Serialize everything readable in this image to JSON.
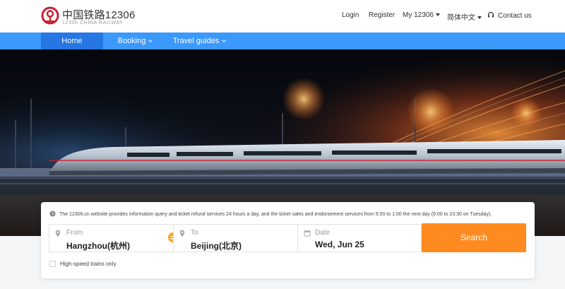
{
  "brand": {
    "title": "中国铁路12306",
    "subtitle": "12306 CHINA RAILWAY"
  },
  "topnav": {
    "login": "Login",
    "register": "Register",
    "my12306": "My 12306",
    "language": "简体中文",
    "contact": "Contact us"
  },
  "mainnav": {
    "home": "Home",
    "booking": "Booking",
    "guides": "Travel guides"
  },
  "carousel": {
    "slide_count": 3,
    "active_slide": 3
  },
  "search": {
    "notice": "The 12306.cn website provides information query and ticket refund services 24 hours a day, and the ticket sales and endorsement services from 5:00 to 1:00 the next day (5:00 to 23:30 on Tuesday).",
    "from_label": "From",
    "from_value": "Hangzhou(杭州)",
    "to_label": "To",
    "to_value": "Beijing(北京)",
    "date_label": "Date",
    "date_value": "Wed, Jun 25",
    "search_label": "Search",
    "highspeed_label": "High-speed trains only",
    "highspeed_checked": false
  },
  "colors": {
    "nav_blue": "#3b99fc",
    "nav_active": "#2676e3",
    "brand_red": "#c8202f",
    "search_orange": "#ff8a1f"
  },
  "icons": {
    "logo": "railway-logo-icon",
    "contact": "headset-icon",
    "notice": "clock-icon",
    "from": "location-pin-icon",
    "to": "location-pin-icon",
    "date": "calendar-icon",
    "swap": "swap-icon"
  }
}
